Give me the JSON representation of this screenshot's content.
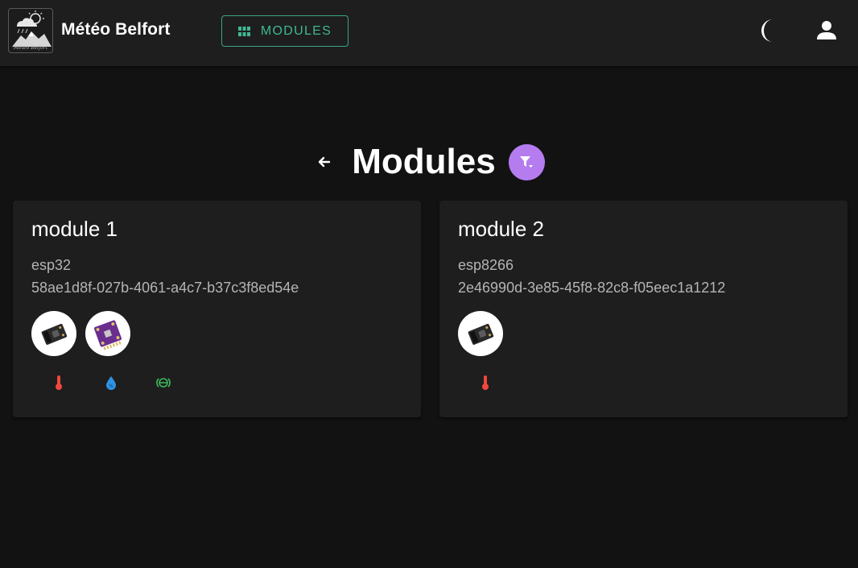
{
  "app": {
    "title": "Météo Belfort",
    "logo_caption": "Météo Belfort"
  },
  "nav": {
    "modules_label": "MODULES",
    "accent_color": "#3fb894"
  },
  "page": {
    "title": "Modules",
    "filter_color": "#b57cf0"
  },
  "modules": [
    {
      "name": "module 1",
      "type": "esp32",
      "id": "58ae1d8f-027b-4061-a4c7-b37c3f8ed54e",
      "sensors": [
        "temperature-sensor-board",
        "bme280-sensor-board"
      ],
      "measures": [
        "temperature",
        "humidity",
        "pressure"
      ]
    },
    {
      "name": "module 2",
      "type": "esp8266",
      "id": "2e46990d-3e85-45f8-82c8-f05eec1a1212",
      "sensors": [
        "temperature-sensor-board"
      ],
      "measures": [
        "temperature"
      ]
    }
  ],
  "colors": {
    "temperature": "#f0483e",
    "humidity": "#2f93e6",
    "pressure": "#3eb85a"
  }
}
